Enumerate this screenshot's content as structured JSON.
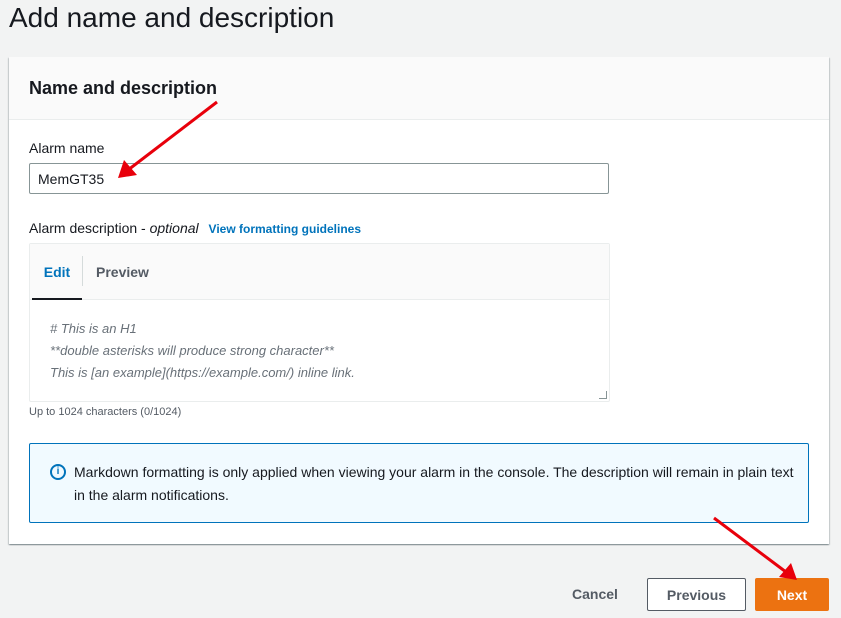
{
  "page": {
    "title": "Add name and description"
  },
  "panel": {
    "title": "Name and description",
    "alarm_name": {
      "label": "Alarm name",
      "value": "MemGT35"
    },
    "alarm_description": {
      "label": "Alarm description - ",
      "optional": "optional",
      "link": "View formatting guidelines",
      "tabs": {
        "edit": "Edit",
        "preview": "Preview"
      },
      "placeholder_lines": [
        "# This is an H1",
        "**double asterisks will produce strong character**",
        "This is [an example](https://example.com/) inline link."
      ],
      "hint": "Up to 1024 characters (0/1024)"
    },
    "info": {
      "icon": "info-icon",
      "text": "Markdown formatting is only applied when viewing your alarm in the console. The description will remain in plain text in the alarm notifications."
    }
  },
  "footer": {
    "cancel": "Cancel",
    "previous": "Previous",
    "next": "Next"
  },
  "colors": {
    "primary": "#ec7211",
    "link": "#0073bb",
    "annotation_arrow": "#e8000b"
  }
}
